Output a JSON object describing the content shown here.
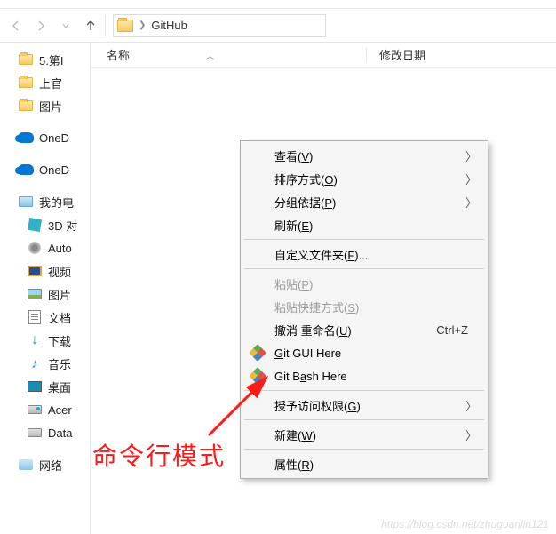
{
  "nav": {
    "folder_name": "GitHub"
  },
  "columns": {
    "name": "名称",
    "date": "修改日期"
  },
  "tree": {
    "items": [
      {
        "label": "5.第I",
        "icon": "folder",
        "sub": false
      },
      {
        "label": "上官",
        "icon": "folder",
        "sub": false
      },
      {
        "label": "图片",
        "icon": "folder",
        "sub": false
      },
      {
        "gap": true
      },
      {
        "label": "OneD",
        "icon": "onedrive",
        "sub": false
      },
      {
        "gap": true
      },
      {
        "label": "OneD",
        "icon": "onedrive",
        "sub": false
      },
      {
        "gap": true
      },
      {
        "label": "我的电",
        "icon": "pc",
        "sub": false
      },
      {
        "label": "3D 对",
        "icon": "3d",
        "sub": true
      },
      {
        "label": "Auto",
        "icon": "auto",
        "sub": true
      },
      {
        "label": "视频",
        "icon": "video",
        "sub": true
      },
      {
        "label": "图片",
        "icon": "pic",
        "sub": true
      },
      {
        "label": "文档",
        "icon": "doc",
        "sub": true
      },
      {
        "label": "下载",
        "icon": "dl",
        "sub": true
      },
      {
        "label": "音乐",
        "icon": "music",
        "sub": true
      },
      {
        "label": "桌面",
        "icon": "desk",
        "sub": true
      },
      {
        "label": "Acer",
        "icon": "acer",
        "sub": true
      },
      {
        "label": "Data",
        "icon": "drive",
        "sub": true
      },
      {
        "gap": true
      },
      {
        "label": "网络",
        "icon": "net",
        "sub": false
      }
    ]
  },
  "context_menu": {
    "items": [
      {
        "label": "查看",
        "accel": "V",
        "submenu": true
      },
      {
        "label": "排序方式",
        "accel": "O",
        "submenu": true
      },
      {
        "label": "分组依据",
        "accel": "P",
        "submenu": true
      },
      {
        "label": "刷新",
        "accel": "E"
      },
      {
        "divider": true
      },
      {
        "label": "自定义文件夹",
        "accel": "F",
        "suffix": "..."
      },
      {
        "divider": true
      },
      {
        "label": "粘贴",
        "accel": "P",
        "disabled": true
      },
      {
        "label": "粘贴快捷方式",
        "accel": "S",
        "disabled": true
      },
      {
        "label": "撤消 重命名",
        "accel": "U",
        "shortcut": "Ctrl+Z"
      },
      {
        "label": "Git GUI Here",
        "icon": "git",
        "accel_inline": "G"
      },
      {
        "label": "Git Bash Here",
        "icon": "git",
        "accel_inline": "a"
      },
      {
        "divider": true
      },
      {
        "label": "授予访问权限",
        "accel": "G",
        "submenu": true
      },
      {
        "divider": true
      },
      {
        "label": "新建",
        "accel": "W",
        "submenu": true
      },
      {
        "divider": true
      },
      {
        "label": "属性",
        "accel": "R"
      }
    ]
  },
  "annotation": "命令行模式",
  "watermark": "https://blog.csdn.net/zhuguanlin121"
}
